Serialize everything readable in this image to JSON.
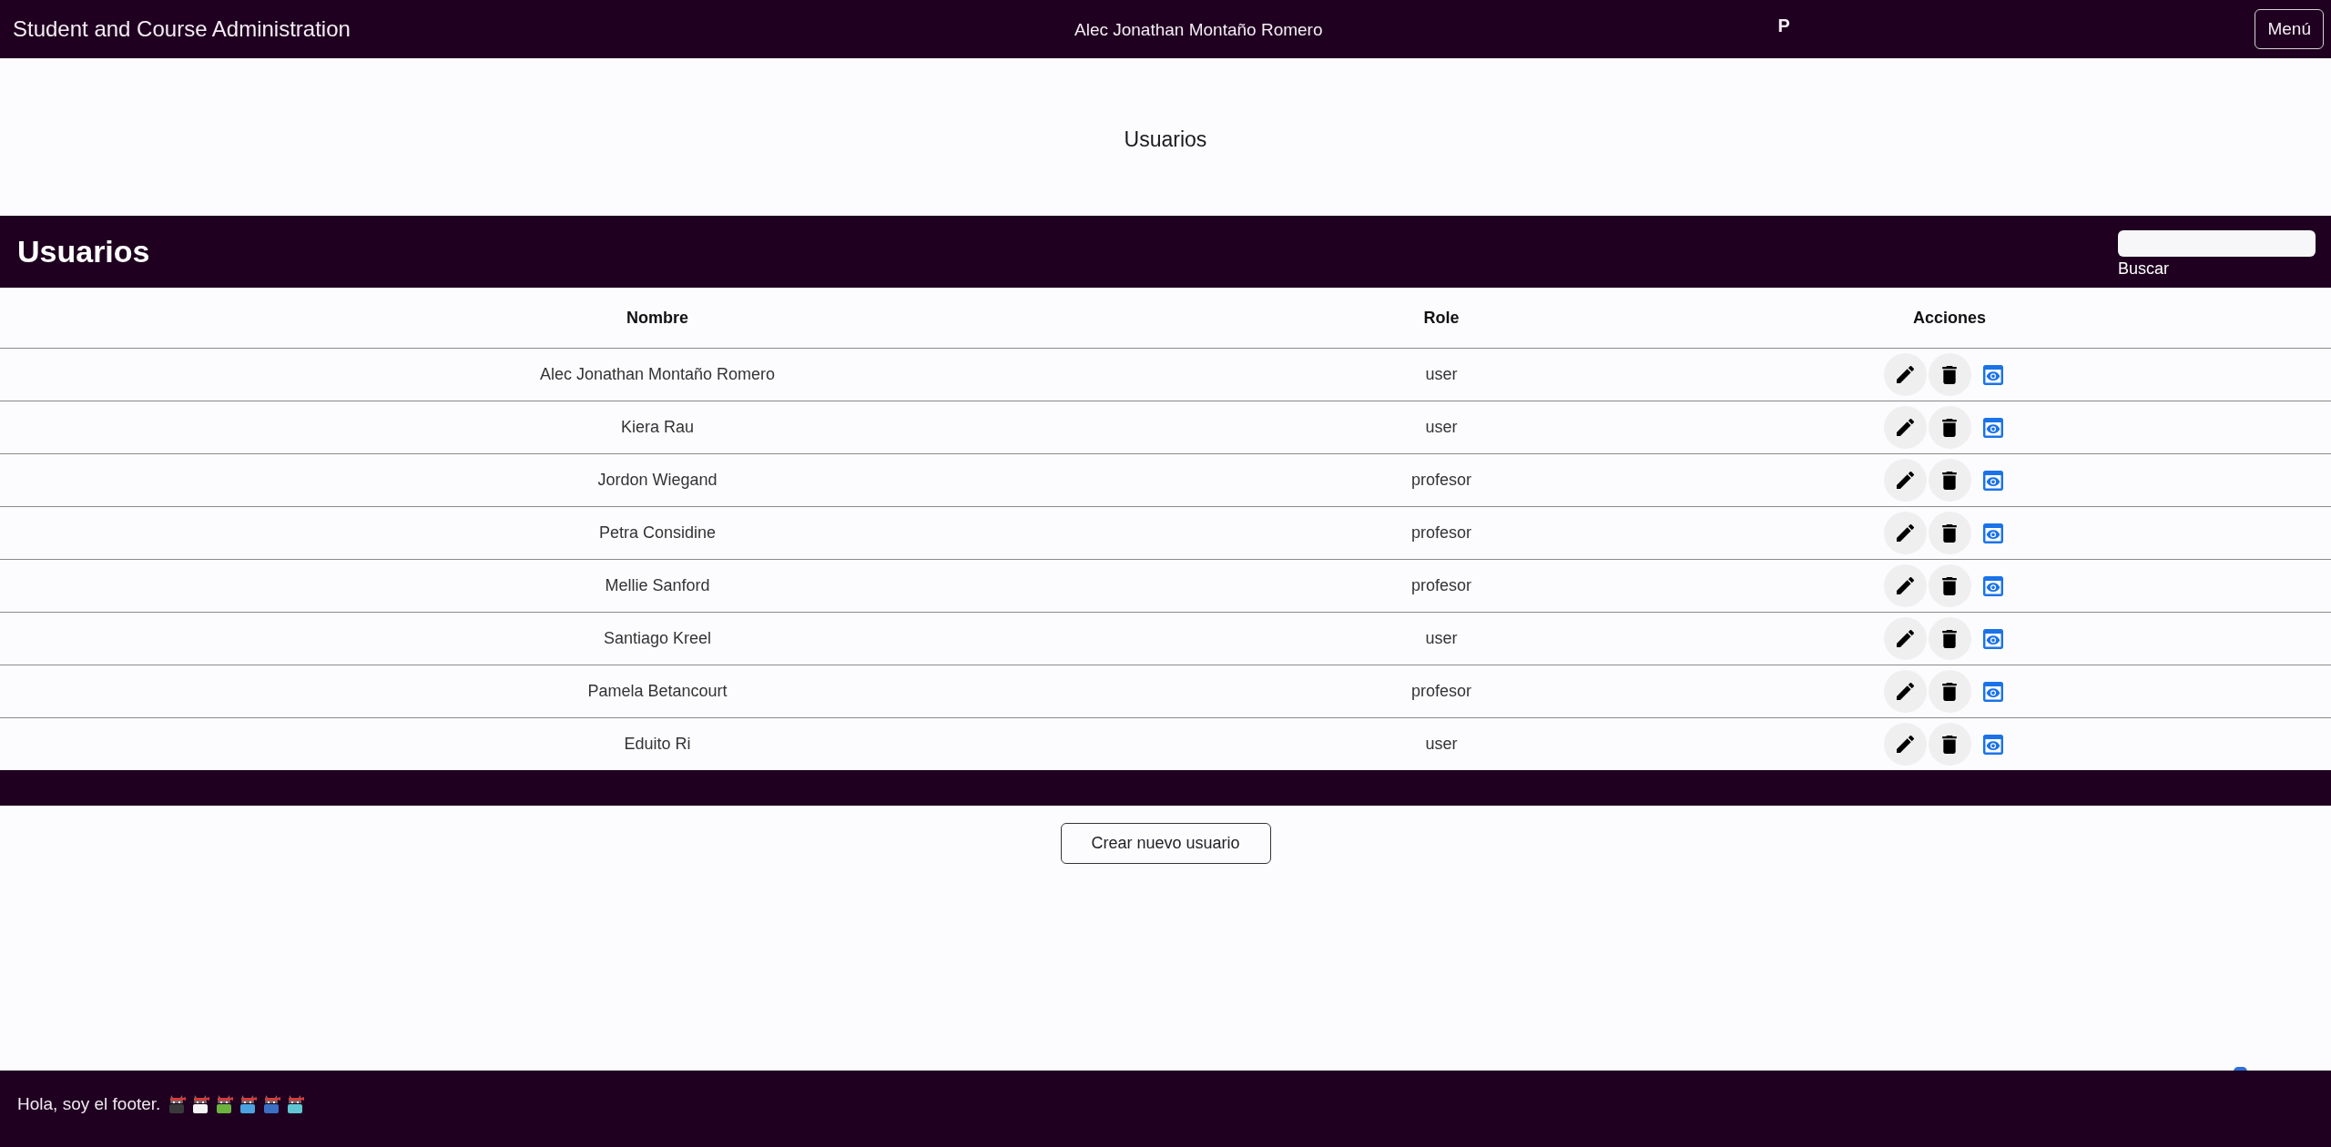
{
  "navbar": {
    "title": "Student and Course Administration",
    "user_name": "Alec Jonathan Montaño Romero",
    "initial": "P",
    "menu_button": "Menú"
  },
  "page_heading": "Usuarios",
  "panel": {
    "title": "Usuarios",
    "search": {
      "label": "Buscar"
    }
  },
  "table": {
    "columns": [
      "Nombre",
      "Role",
      "Acciones"
    ],
    "rows": [
      {
        "name": "Alec Jonathan Montaño Romero",
        "role": "user"
      },
      {
        "name": "Kiera Rau",
        "role": "user"
      },
      {
        "name": "Jordon Wiegand",
        "role": "profesor"
      },
      {
        "name": "Petra Considine",
        "role": "profesor"
      },
      {
        "name": "Mellie Sanford",
        "role": "profesor"
      },
      {
        "name": "Santiago Kreel",
        "role": "user"
      },
      {
        "name": "Pamela Betancourt",
        "role": "profesor"
      },
      {
        "name": "Eduito Ri",
        "role": "user"
      }
    ]
  },
  "create_button": "Crear nuevo usuario",
  "footer": {
    "text": "Hola, soy el footer."
  }
}
